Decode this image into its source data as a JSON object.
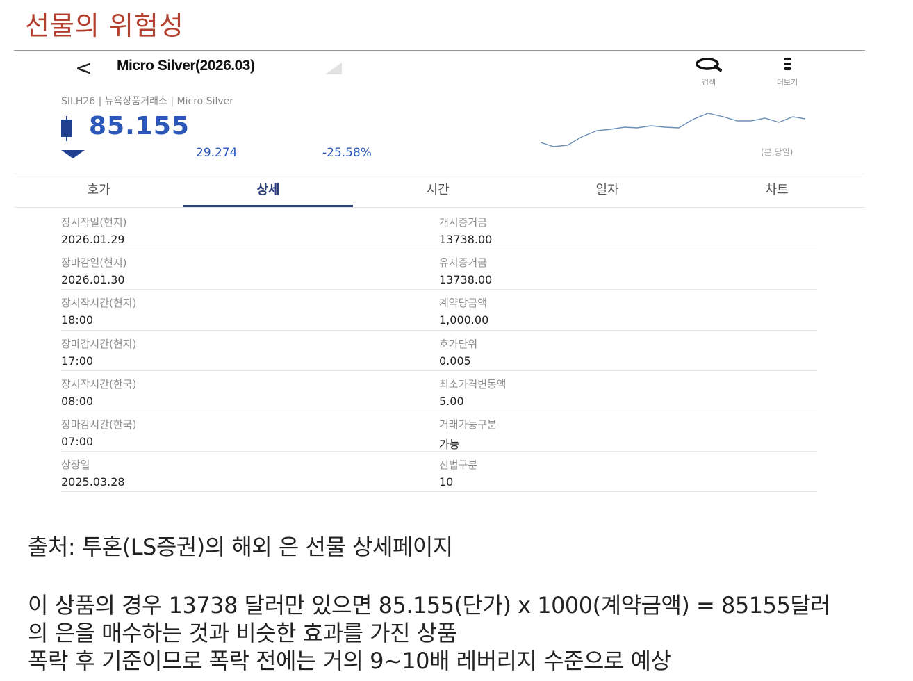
{
  "slide": {
    "title": "선물의 위험성"
  },
  "header": {
    "back_label": "<",
    "product_name": "Micro Silver(2026.03)",
    "search_label": "검색",
    "more_label": "더보기"
  },
  "info": {
    "sub_info": "SILH26 | 뉴욕상품거래소 | Micro Silver",
    "price": "85.155",
    "change": "29.274",
    "change_pct": "-25.58%",
    "sparkline_label": "(분,당일)",
    "price_color": "#2b57b8"
  },
  "tabs": [
    {
      "label": "호가"
    },
    {
      "label": "상세"
    },
    {
      "label": "시간"
    },
    {
      "label": "일자"
    },
    {
      "label": "차트"
    }
  ],
  "active_tab": "상세",
  "details": [
    {
      "left_key": "장시작일(현지)",
      "left_value": "2026.01.29",
      "right_key": "개시증거금",
      "right_value": "13738.00"
    },
    {
      "left_key": "장마감일(현지)",
      "left_value": "2026.01.30",
      "right_key": "유지증거금",
      "right_value": "13738.00"
    },
    {
      "left_key": "장시작시간(현지)",
      "left_value": "18:00",
      "right_key": "계약당금액",
      "right_value": "1,000.00"
    },
    {
      "left_key": "장마감시간(현지)",
      "left_value": "17:00",
      "right_key": "호가단위",
      "right_value": "0.005"
    },
    {
      "left_key": "장시작시간(한국)",
      "left_value": "08:00",
      "right_key": "최소가격변동액",
      "right_value": "5.00"
    },
    {
      "left_key": "장마감시간(한국)",
      "left_value": "07:00",
      "right_key": "거래가능구분",
      "right_value": "가능"
    },
    {
      "left_key": "상장일",
      "left_value": "2025.03.28",
      "right_key": "진법구분",
      "right_value": "10"
    }
  ],
  "caption": {
    "source": "출처: 투혼(LS증권)의 해외 은 선물 상세페이지",
    "line1": "이 상품의 경우 13738 달러만 있으면 85.155(단가) x 1000(계약금액) = 85155달러",
    "line2": "의 은을 매수하는 것과 비슷한 효과를 가진 상품",
    "line3": "폭락 후 기준이므로 폭락 전에는 거의 9~10배 레버리지 수준으로 예상"
  }
}
